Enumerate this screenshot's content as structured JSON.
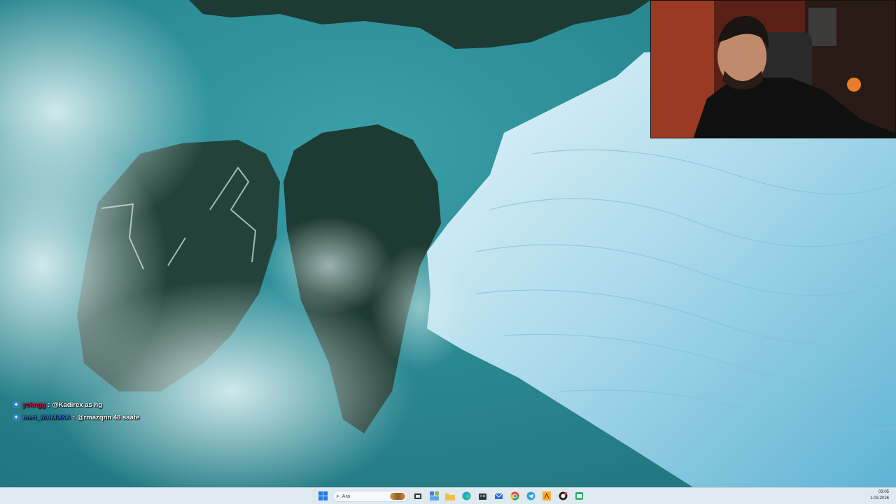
{
  "chat": {
    "lines": [
      {
        "user": "yekngg",
        "message": "@Kadirex as hg"
      },
      {
        "user": "mert_MAMUKA",
        "message": "@rmazqnn 48 saate"
      }
    ]
  },
  "taskbar": {
    "search_placeholder": "Ara",
    "icons": [
      "windows-start-icon",
      "taskview-icon",
      "widgets-icon",
      "file-explorer-icon",
      "edge-icon",
      "store-icon",
      "mail-icon",
      "chrome-icon",
      "telegram-icon",
      "pdf-icon",
      "obs-icon",
      "app-icon"
    ],
    "time": "03:05",
    "date": "1.03.2026"
  },
  "colors": {
    "taskbar_bg": "#dfe9f0",
    "chat_user_a": "#c0124b",
    "chat_user_b": "#2a6bd8"
  }
}
